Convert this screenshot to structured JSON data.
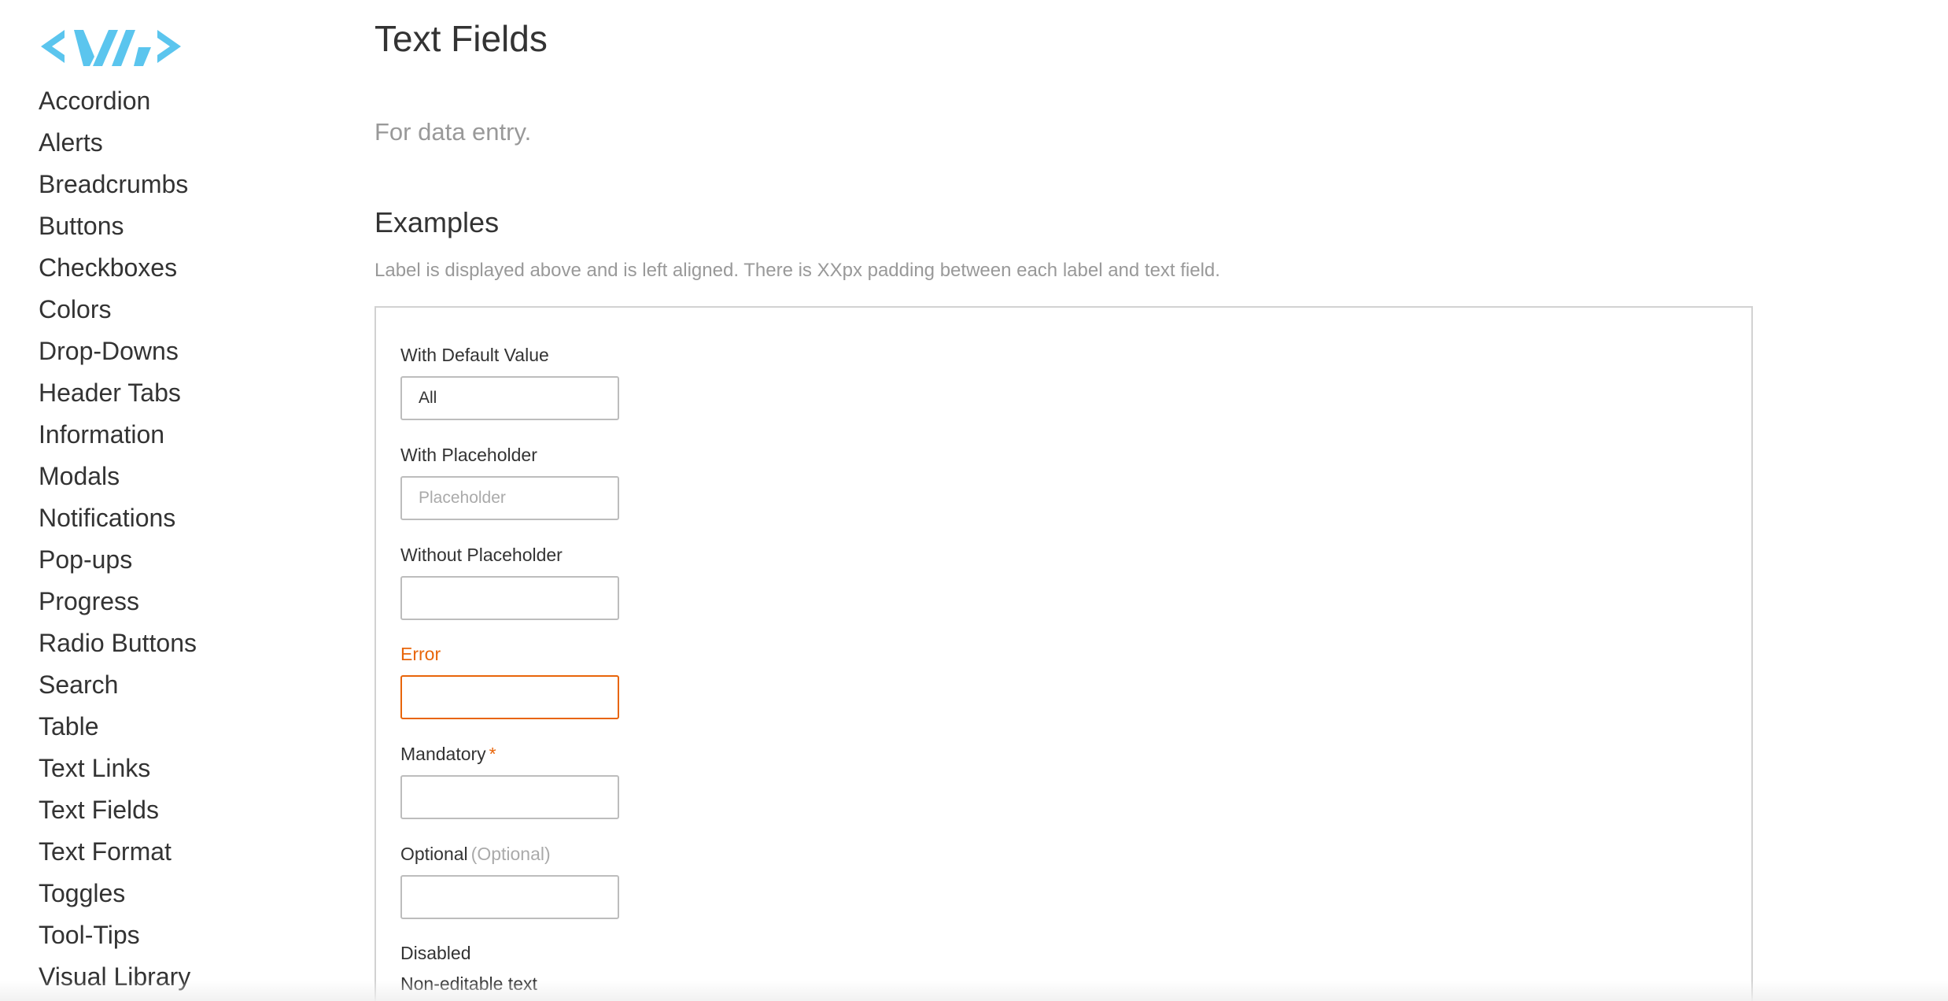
{
  "sidebar": {
    "logo_icon": "va-logo-icon",
    "brand_color": "#5bc5ee",
    "items": [
      {
        "label": "Accordion"
      },
      {
        "label": "Alerts"
      },
      {
        "label": "Breadcrumbs"
      },
      {
        "label": "Buttons"
      },
      {
        "label": "Checkboxes"
      },
      {
        "label": "Colors"
      },
      {
        "label": "Drop-Downs"
      },
      {
        "label": "Header Tabs"
      },
      {
        "label": "Information"
      },
      {
        "label": "Modals"
      },
      {
        "label": "Notifications"
      },
      {
        "label": "Pop-ups"
      },
      {
        "label": "Progress"
      },
      {
        "label": "Radio Buttons"
      },
      {
        "label": "Search"
      },
      {
        "label": "Table"
      },
      {
        "label": "Text Links"
      },
      {
        "label": "Text Fields"
      },
      {
        "label": "Text Format"
      },
      {
        "label": "Toggles"
      },
      {
        "label": "Tool-Tips"
      },
      {
        "label": "Visual Library"
      }
    ]
  },
  "main": {
    "title": "Text Fields",
    "subtitle": "For data entry.",
    "section_title": "Examples",
    "section_desc": "Label is displayed above and is left aligned. There is XXpx padding between each label and text field.",
    "error_color": "#e8650a",
    "fields": {
      "default_value": {
        "label": "With Default Value",
        "value": "All"
      },
      "placeholder": {
        "label": "With Placeholder",
        "placeholder": "Placeholder"
      },
      "no_placeholder": {
        "label": "Without Placeholder"
      },
      "error": {
        "label": "Error"
      },
      "mandatory": {
        "label": "Mandatory",
        "required_marker": "*"
      },
      "optional": {
        "label": "Optional",
        "optional_marker": "(Optional)"
      },
      "disabled": {
        "label": "Disabled",
        "text": "Non-editable text"
      }
    }
  }
}
